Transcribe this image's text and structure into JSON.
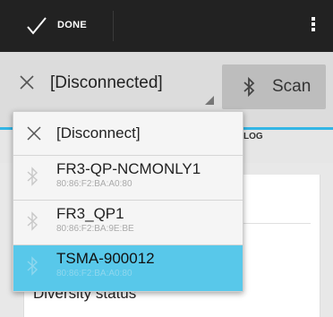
{
  "action_bar": {
    "done_label": "DONE",
    "done_icon": "check-icon",
    "overflow_icon": "overflow-menu-icon"
  },
  "device_bar": {
    "selected_device": "[Disconnected]",
    "scan_label": "Scan",
    "close_icon": "close-icon",
    "bluetooth_icon": "bluetooth-icon"
  },
  "tabs": {
    "log_tab_fragment": "LOG",
    "accent_color": "#33b5e5"
  },
  "content": {
    "diversity_label": "Diversity status"
  },
  "dropdown": {
    "disconnect_label": "[Disconnect]",
    "selected_color": "#58c8ea",
    "devices": [
      {
        "name": "FR3-QP-NCMONLY1",
        "mac": "80:86:F2:BA:A0:80"
      },
      {
        "name": "FR3_QP1",
        "mac": "80:86:F2:BA:9E:BE"
      },
      {
        "name": "TSMA-900012",
        "mac": "80:86:F2:BA:A0:80"
      }
    ]
  }
}
